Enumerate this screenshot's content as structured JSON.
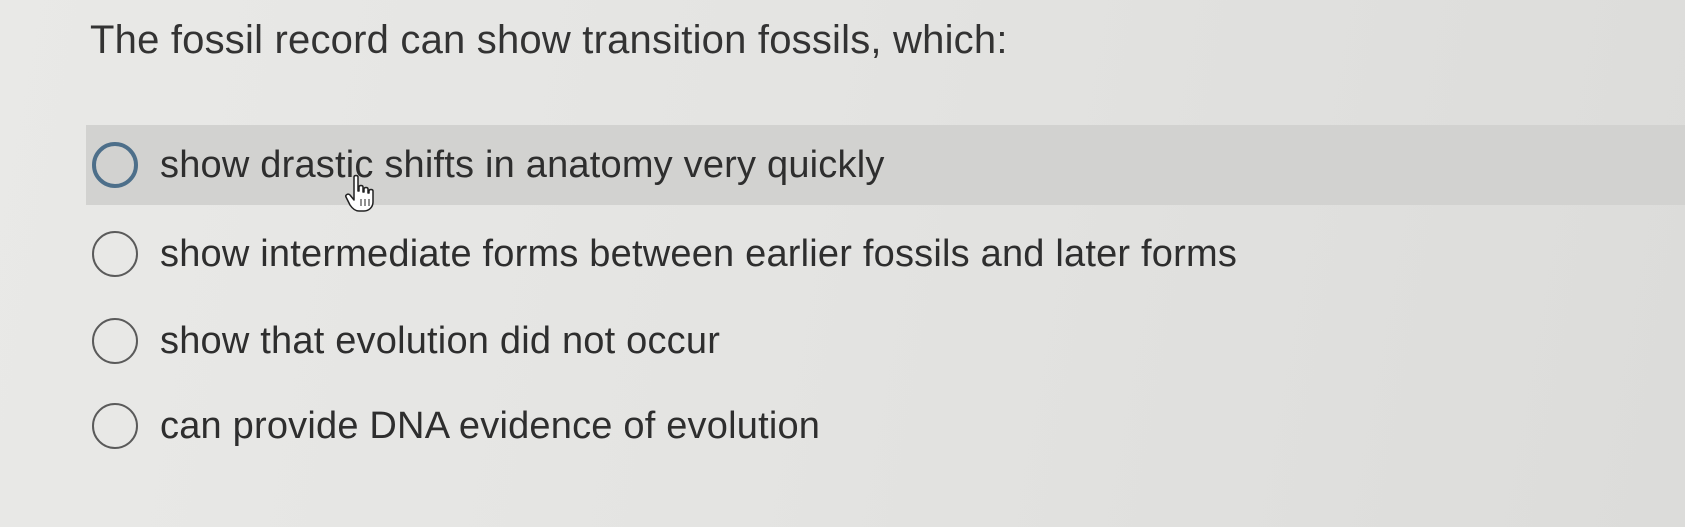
{
  "question": {
    "text": "The fossil record can show transition fossils, which:"
  },
  "options": [
    {
      "label": "show drastic shifts in anatomy very quickly",
      "hovered": true
    },
    {
      "label": "show intermediate forms between earlier fossils and later forms",
      "hovered": false
    },
    {
      "label": "show that evolution did not occur",
      "hovered": false
    },
    {
      "label": "can provide DNA evidence of evolution",
      "hovered": false
    }
  ],
  "cursor": {
    "icon": "hand-pointer-icon"
  },
  "colors": {
    "hover_background": "#d2d2d0",
    "focus_ring": "#4d6f8a"
  }
}
